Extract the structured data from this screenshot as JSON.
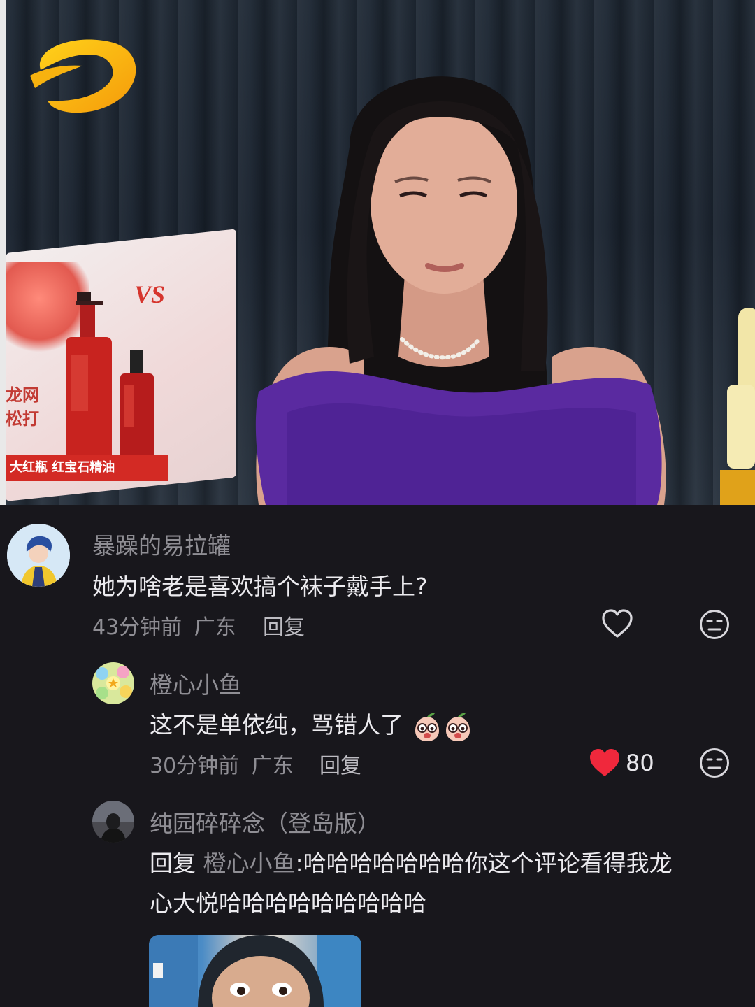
{
  "video": {
    "sponsor_brand": "VS",
    "sponsor_text_lines": [
      "龙网",
      "松打"
    ],
    "sponsor_banner": "大红瓶 红宝石精油"
  },
  "comments": [
    {
      "username": "暴躁的易拉罐",
      "text": "她为啥老是喜欢搞个袜子戴手上?",
      "time": "43分钟前",
      "location": "广东",
      "reply_label": "回复",
      "liked": false,
      "like_count": ""
    },
    {
      "username": "橙心小鱼",
      "text": "这不是单依纯，骂错人了",
      "emojis": [
        "peach-face-emoji",
        "peach-face-emoji"
      ],
      "time": "30分钟前",
      "location": "广东",
      "reply_label": "回复",
      "liked": true,
      "like_count": "80"
    },
    {
      "username": "纯园碎碎念（登岛版）",
      "reply_prefix": "回复",
      "reply_target": "橙心小鱼",
      "reply_separator": ":",
      "text_line1": "哈哈哈哈哈哈哈你这个评论看得我龙",
      "text_line2": "心大悦哈哈哈哈哈哈哈哈哈"
    }
  ],
  "colors": {
    "background": "#18171c",
    "like_red": "#f0283c",
    "username_gray": "#8f8e94",
    "text_white": "#ecebef"
  }
}
